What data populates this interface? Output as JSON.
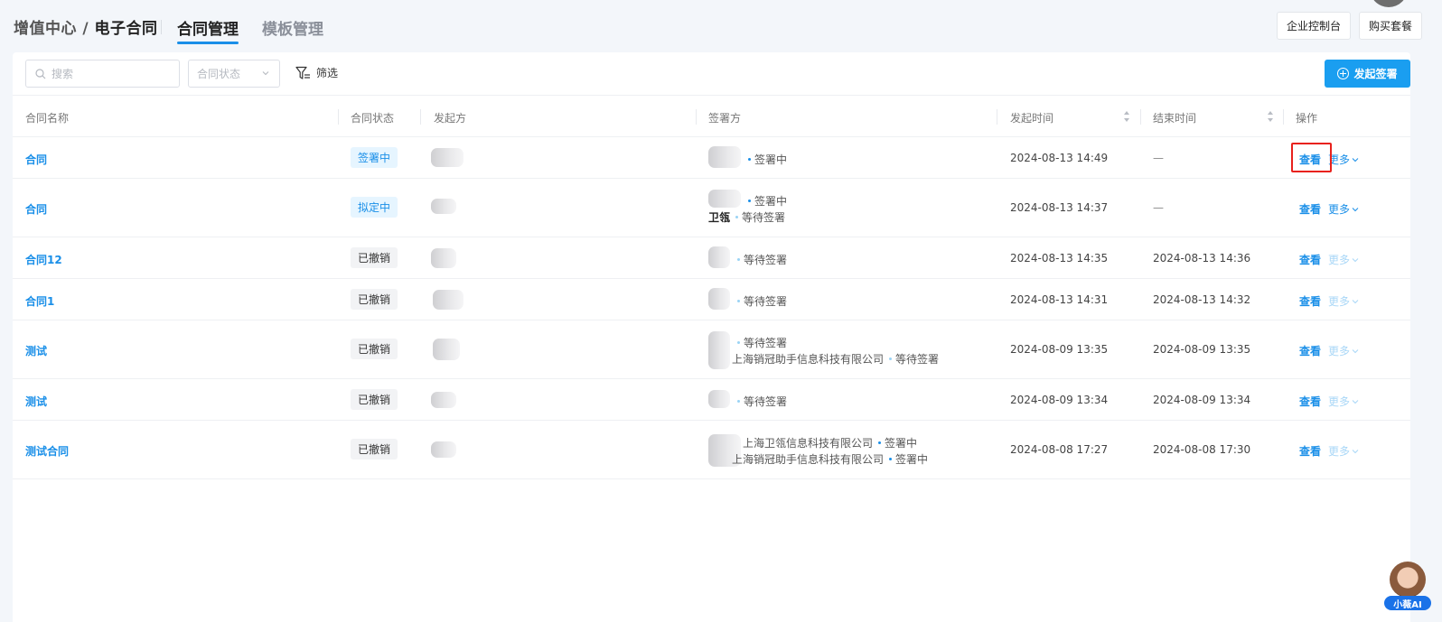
{
  "header": {
    "breadcrumb_parent": "增值中心",
    "breadcrumb_sep": " / ",
    "breadcrumb_current": "电子合同",
    "tabs": [
      {
        "label": "合同管理",
        "active": true
      },
      {
        "label": "模板管理",
        "active": false
      }
    ],
    "console_button": "企业控制台",
    "buy_button": "购买套餐"
  },
  "toolbar": {
    "search_placeholder": "搜索",
    "status_placeholder": "合同状态",
    "filter_label": "筛选",
    "start_button": "发起签署"
  },
  "table": {
    "columns": [
      "合同名称",
      "合同状态",
      "发起方",
      "签署方",
      "发起时间",
      "结束时间",
      "操作"
    ],
    "rows": [
      {
        "name": "合同",
        "status": "签署中",
        "status_style": "blue",
        "signers": [
          {
            "company": "",
            "state": "签署中"
          }
        ],
        "start_time": "2024-08-13 14:49",
        "end_time": "—",
        "view": "查看",
        "more": "更多",
        "more_enabled": true
      },
      {
        "name": "合同",
        "status": "拟定中",
        "status_style": "blue",
        "signers": [
          {
            "company": "",
            "state": "签署中"
          },
          {
            "company": "卫瓴",
            "state": "等待签署"
          }
        ],
        "start_time": "2024-08-13 14:37",
        "end_time": "—",
        "view": "查看",
        "more": "更多",
        "more_enabled": true
      },
      {
        "name": "合同12",
        "status": "已撤销",
        "status_style": "gray",
        "signers": [
          {
            "company": "",
            "state": "等待签署"
          }
        ],
        "start_time": "2024-08-13 14:35",
        "end_time": "2024-08-13 14:36",
        "view": "查看",
        "more": "更多",
        "more_enabled": false
      },
      {
        "name": "合同1",
        "status": "已撤销",
        "status_style": "gray",
        "signers": [
          {
            "company": "",
            "state": "等待签署"
          }
        ],
        "start_time": "2024-08-13 14:31",
        "end_time": "2024-08-13 14:32",
        "view": "查看",
        "more": "更多",
        "more_enabled": false
      },
      {
        "name": "测试",
        "status": "已撤销",
        "status_style": "gray",
        "signers": [
          {
            "company": "",
            "state": "等待签署"
          },
          {
            "company": "上海销冠助手信息科技有限公司",
            "state": "等待签署"
          }
        ],
        "start_time": "2024-08-09 13:35",
        "end_time": "2024-08-09 13:35",
        "view": "查看",
        "more": "更多",
        "more_enabled": false
      },
      {
        "name": "测试",
        "status": "已撤销",
        "status_style": "gray",
        "signers": [
          {
            "company": "",
            "state": "等待签署"
          }
        ],
        "start_time": "2024-08-09 13:34",
        "end_time": "2024-08-09 13:34",
        "view": "查看",
        "more": "更多",
        "more_enabled": false
      },
      {
        "name": "测试合同",
        "status": "已撤销",
        "status_style": "gray",
        "signers": [
          {
            "company": "上海卫瓴信息科技有限公司",
            "state": "签署中"
          },
          {
            "company": "上海销冠助手信息科技有限公司",
            "state": "签署中"
          }
        ],
        "start_time": "2024-08-08 17:27",
        "end_time": "2024-08-08 17:30",
        "view": "查看",
        "more": "更多",
        "more_enabled": false
      }
    ]
  },
  "assistant": {
    "label": "小薇AI"
  },
  "colors": {
    "accent": "#1a9ef0",
    "link": "#1a8fe8",
    "highlight": "#e8211c"
  }
}
